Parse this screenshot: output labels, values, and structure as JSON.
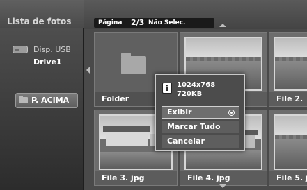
{
  "sidebar": {
    "title": "Lista de fotos",
    "device": {
      "label": "Disp. USB",
      "name": "Drive1"
    },
    "up_button_label": "P. ACIMA"
  },
  "pagebar": {
    "page_label": "Página",
    "page_value": "2/3",
    "selection_label": "Não Selec."
  },
  "grid": {
    "items": [
      {
        "label": "Folder"
      },
      {
        "label": ""
      },
      {
        "label": "File 2."
      },
      {
        "label": "File 3. jpg"
      },
      {
        "label": "File 4. jpg"
      },
      {
        "label": "File 5. j"
      }
    ]
  },
  "popup": {
    "info_icon_glyph": "i",
    "resolution": "1024x768",
    "filesize": "720KB",
    "menu": [
      "Exibir",
      "Marcar Tudo",
      "Cancelar"
    ]
  }
}
